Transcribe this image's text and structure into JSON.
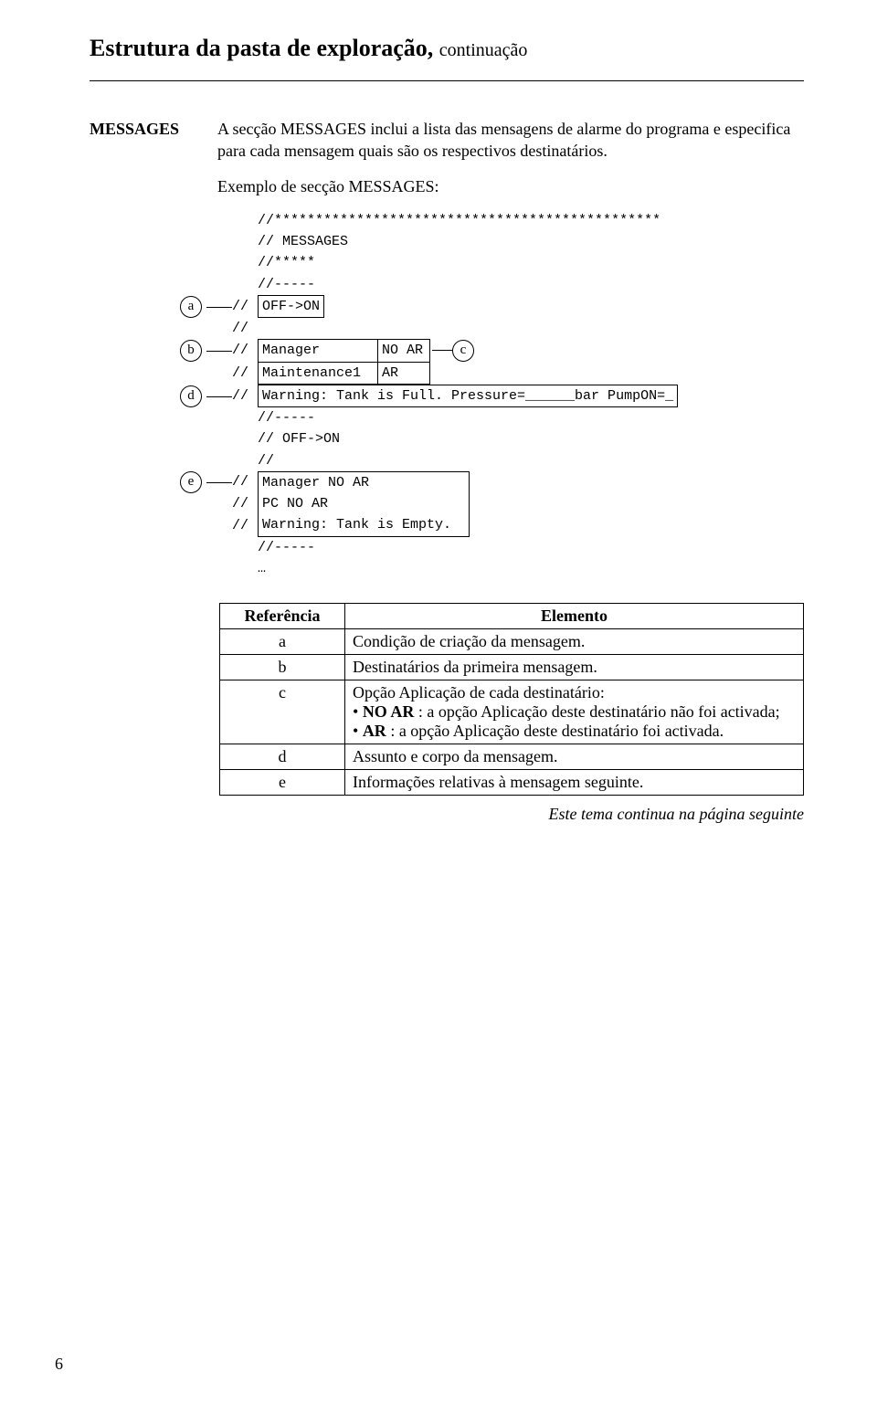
{
  "heading": {
    "title": "Estrutura da pasta de exploração, ",
    "cont": "continuação"
  },
  "section": {
    "label": "MESSAGES",
    "para1": "A secção MESSAGES inclui a lista das mensagens de alarme do programa e especifica para cada mensagem quais são os respectivos destinatários.",
    "para2": "Exemplo de secção MESSAGES:"
  },
  "code": {
    "l1": "//***********************************************",
    "l2": "// MESSAGES",
    "l3": "//*****",
    "l4": "//-----",
    "slashes": "//",
    "off_on": "OFF->ON",
    "mgr_l": "Manager",
    "mgr_r": "NO AR",
    "mnt_l": "Maintenance1",
    "mnt_r": "AR",
    "d_line": " Warning: Tank is Full. Pressure=______bar  PumpON=_",
    "dash": "//-----",
    "off_on2": "// OFF->ON",
    "blank2": "//",
    "e1": " Manager      NO AR",
    "e2": " PC           NO AR",
    "e3": " Warning: Tank is Empty.",
    "dash2": "//-----",
    "dots": "…"
  },
  "markers": {
    "a": "a",
    "b": "b",
    "c": "c",
    "d": "d",
    "e": "e"
  },
  "table": {
    "h1": "Referência",
    "h2": "Elemento",
    "rows": {
      "a": "Condição de criação da mensagem.",
      "b": "Destinatários da primeira mensagem.",
      "c_intro": "Opção Aplicação de cada destinatário:",
      "c_b1_pre": "NO AR",
      "c_b1_post": " : a opção Aplicação deste destinatário não foi activada;",
      "c_b2_pre": "AR",
      "c_b2_post": " : a opção Aplicação deste destinatário foi activada.",
      "d": "Assunto e corpo da mensagem.",
      "e": "Informações relativas à mensagem seguinte."
    }
  },
  "footer": {
    "cont": "Este tema continua na página seguinte",
    "pagenum": "6"
  }
}
